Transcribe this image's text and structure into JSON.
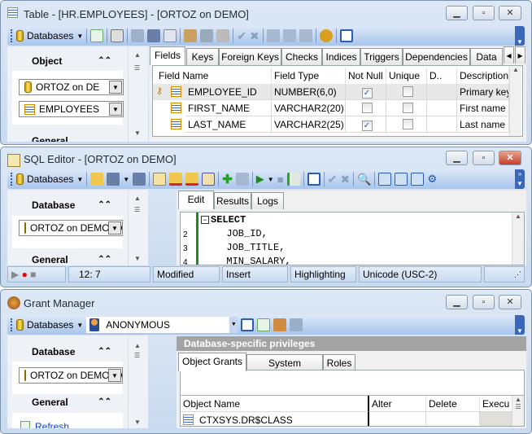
{
  "table_window": {
    "title": "Table - [HR.EMPLOYEES] - [ORTOZ on DEMO]",
    "toolbar": {
      "databases_label": "Databases"
    },
    "left_panel": {
      "section_title": "Object",
      "database_combo": "ORTOZ on DE",
      "table_combo": "EMPLOYEES",
      "next_section": "General"
    },
    "tabs": [
      "Fields",
      "Keys",
      "Foreign Keys",
      "Checks",
      "Indices",
      "Triggers",
      "Dependencies",
      "Data"
    ],
    "columns": [
      "Field Name",
      "Field Type",
      "Not Null",
      "Unique",
      "D..",
      "Description"
    ],
    "rows": [
      {
        "name": "EMPLOYEE_ID",
        "type": "NUMBER(6,0)",
        "not_null": true,
        "unique": false,
        "description": "Primary key",
        "primary_key": true
      },
      {
        "name": "FIRST_NAME",
        "type": "VARCHAR2(20)",
        "not_null": false,
        "unique": false,
        "description": "First name o",
        "primary_key": false
      },
      {
        "name": "LAST_NAME",
        "type": "VARCHAR2(25)",
        "not_null": true,
        "unique": false,
        "description": "Last name of",
        "primary_key": false
      }
    ]
  },
  "sql_window": {
    "title": "SQL Editor - [ORTOZ on DEMO]",
    "toolbar": {
      "databases_label": "Databases"
    },
    "left_panel": {
      "section_title": "Database",
      "database_combo": "ORTOZ on DEMO [OI",
      "next_section": "General"
    },
    "tabs": [
      "Edit",
      "Results",
      "Logs"
    ],
    "code_lines": [
      {
        "num": "",
        "text": "SELECT"
      },
      {
        "num": "2",
        "text": "  JOB_ID,"
      },
      {
        "num": "3",
        "text": "  JOB_TITLE,"
      },
      {
        "num": "4",
        "text": "  MIN_SALARY,"
      }
    ],
    "status": {
      "position": "12:   7",
      "modified": "Modified",
      "mode": "Insert",
      "highlighting": "Highlighting",
      "encoding": "Unicode (USC-2)"
    }
  },
  "grant_window": {
    "title": "Grant Manager",
    "toolbar": {
      "databases_label": "Databases",
      "user": "ANONYMOUS"
    },
    "left_panel": {
      "section_title": "Database",
      "database_combo": "ORTOZ on DEMO [OI",
      "next_section": "General",
      "refresh_link": "Refresh"
    },
    "header": "Database-specific privileges",
    "tabs": [
      "Object Grants",
      "System Privileges",
      "Roles"
    ],
    "columns": [
      "Object Name",
      "Alter",
      "Delete",
      "Execu"
    ],
    "rows": [
      {
        "name": "CTXSYS.DR$CLASS"
      }
    ]
  },
  "colors": {
    "toolbar_blue": "#a9c5ec",
    "overflow_blue": "#3a67ba",
    "close_red": "#c5402a"
  }
}
